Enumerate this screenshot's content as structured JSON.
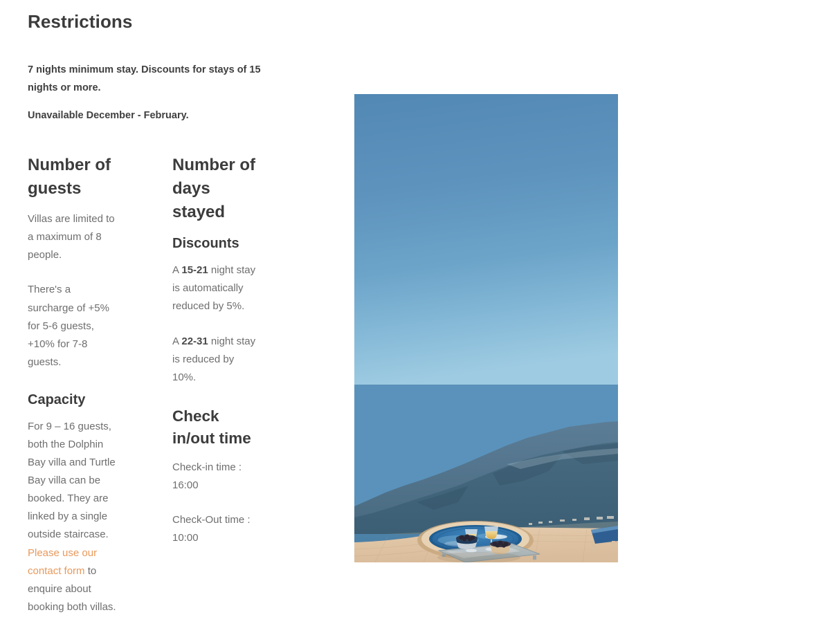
{
  "restrictions": {
    "title": "Restrictions",
    "line1": "7 nights minimum stay. Discounts for stays of 15 nights or more.",
    "line2": "Unavailable December - February."
  },
  "guests_column": {
    "heading": "Number of guests",
    "paragraph1": "Villas are limited to a maximum of 8 people.",
    "paragraph2": "There's a surcharge of +5% for 5-6 guests, +10% for 7-8 guests.",
    "capacity_heading": "Capacity",
    "capacity_text_before": "For 9 – 16 guests, both the Dolphin Bay villa and Turtle Bay villa can be booked. They are linked by a single outside staircase. ",
    "capacity_link": "Please use our contact form",
    "capacity_text_after": " to enquire about booking both villas."
  },
  "days_column": {
    "heading": "Number of days stayed",
    "discounts_heading": "Discounts",
    "discount1_prefix": "A ",
    "discount1_bold": "15-21",
    "discount1_suffix": " night stay is automatically reduced by 5%.",
    "discount2_prefix": "A ",
    "discount2_bold": "22-31",
    "discount2_suffix": " night stay is reduced by 10%.",
    "checkin_heading": "Check in/out time",
    "checkin_text": "Check-in time : 16:00",
    "checkout_text": "Check-Out time : 10:00"
  },
  "photo": {
    "alt": "Infinity pool terrace with jacuzzi, glass railing, sea and mountain view",
    "colors": {
      "sky_top": "#5a8fba",
      "sky_bottom": "#8ec0dc",
      "sea": "#4b7ea4",
      "mountain": "#41637f",
      "deck": "#e2c8a8",
      "pool": "#2f6ea3",
      "accent_link": "#e8995c"
    }
  }
}
